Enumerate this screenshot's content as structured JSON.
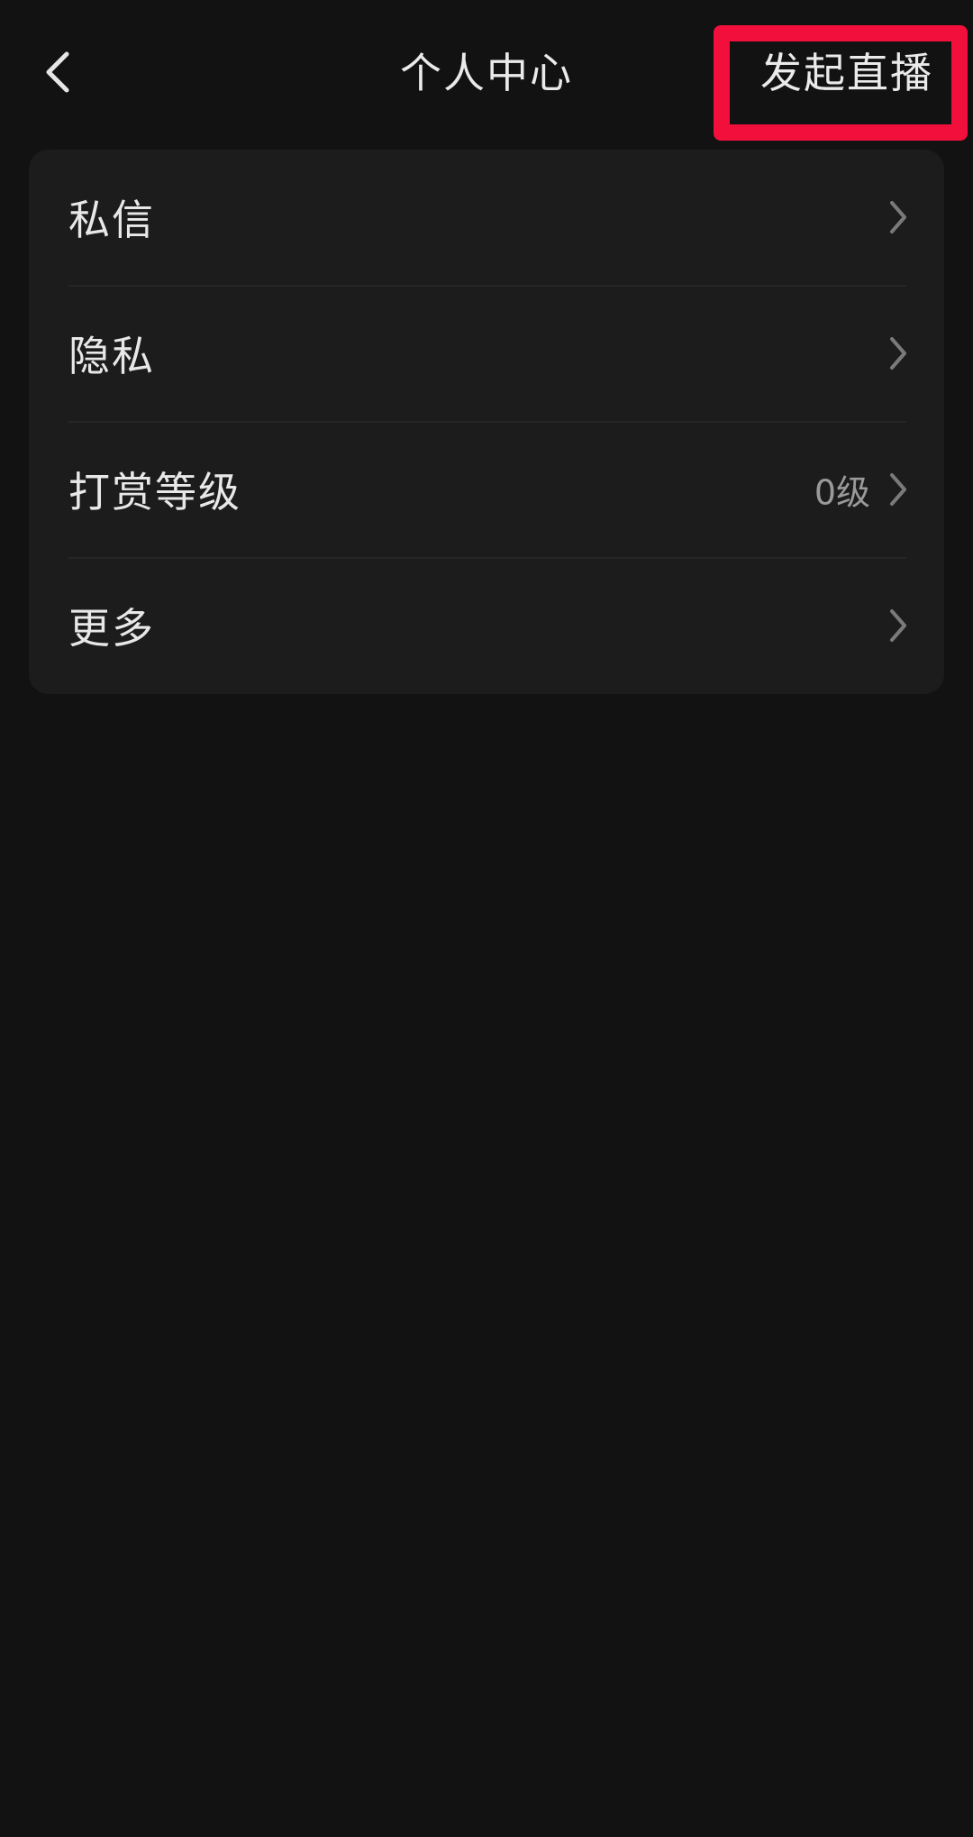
{
  "header": {
    "title": "个人中心",
    "back_icon": "chevron-left-icon",
    "live_button_label": "发起直播",
    "highlight_color": "#f20f3c"
  },
  "menu": {
    "items": [
      {
        "label": "私信",
        "value": "",
        "icon": "chevron-right-icon"
      },
      {
        "label": "隐私",
        "value": "",
        "icon": "chevron-right-icon"
      },
      {
        "label": "打赏等级",
        "value": "0级",
        "icon": "chevron-right-icon"
      },
      {
        "label": "更多",
        "value": "",
        "icon": "chevron-right-icon"
      }
    ]
  },
  "colors": {
    "background": "#121212",
    "card": "#1c1c1c",
    "text": "#e8e8e8",
    "secondary_text": "#9a9a9a"
  }
}
